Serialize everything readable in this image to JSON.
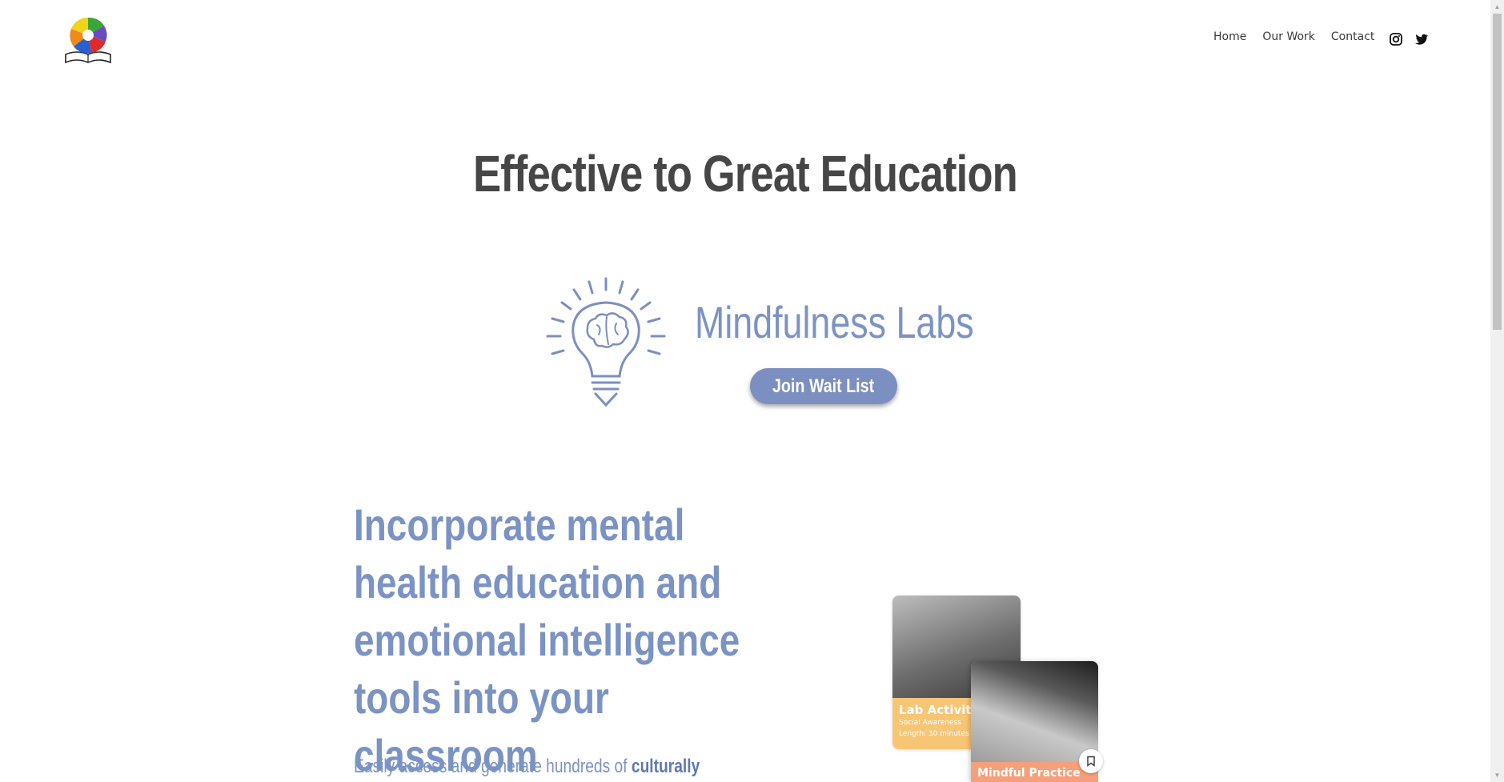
{
  "nav": {
    "items": [
      {
        "label": "Home"
      },
      {
        "label": "Our Work"
      },
      {
        "label": "Contact"
      }
    ],
    "social_icons": [
      "instagram-icon",
      "twitter-icon"
    ]
  },
  "hero": {
    "title": "Effective to Great Education"
  },
  "labs": {
    "name": "Mindfulness Labs",
    "button_label": "Join Wait List",
    "icon": "lightbulb-brain-icon"
  },
  "section": {
    "headline": "Incorporate mental health education and emotional intelligence tools into your classroom",
    "body_prefix": "Easily access and generate hundreds of",
    "body_bold": "culturally"
  },
  "cards": [
    {
      "title": "Lab Activity",
      "line1": "Social Awareness",
      "line2": "Length: 30 minutes"
    },
    {
      "title": "Mindful Practice"
    }
  ],
  "colors": {
    "accent": "#7b93c4",
    "button": "#7b8fc0",
    "title": "#464646",
    "card_lab": "#f7c675",
    "card_practice": "#f5a07a"
  }
}
